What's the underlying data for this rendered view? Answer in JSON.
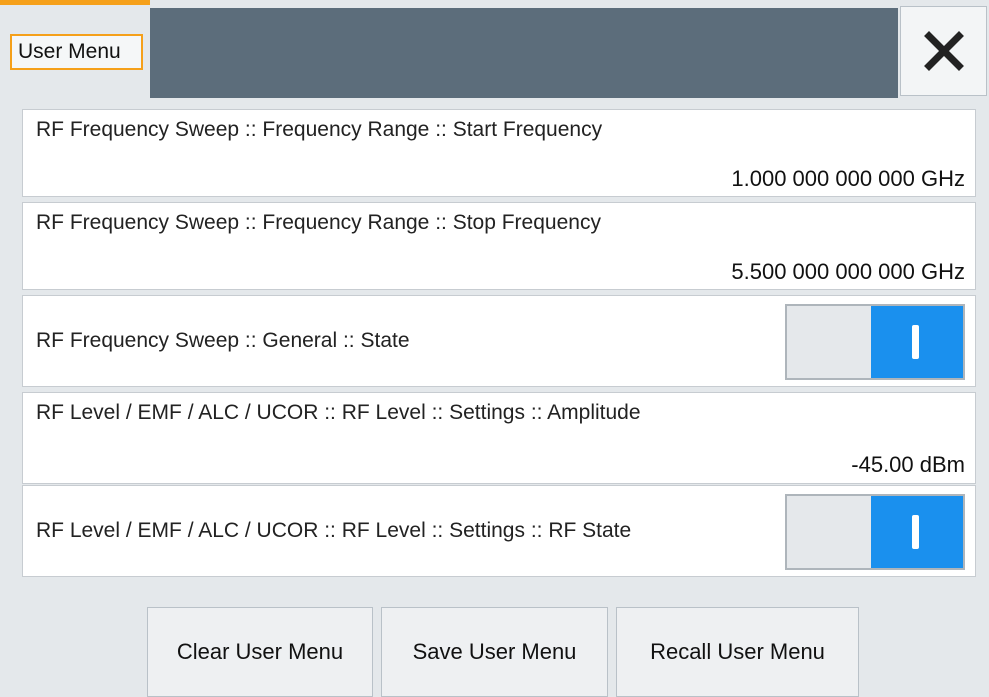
{
  "window": {
    "tab_label": "User Menu",
    "close_icon": "close-icon"
  },
  "rows": [
    {
      "label": "RF Frequency Sweep :: Frequency Range :: Start Frequency",
      "value": "1.000 000 000 000 GHz"
    },
    {
      "label": "RF Frequency Sweep :: Frequency Range :: Stop Frequency",
      "value": "5.500 000 000 000 GHz"
    },
    {
      "label": "RF Frequency Sweep :: General :: State",
      "toggle_state": "on"
    },
    {
      "label": "RF Level / EMF / ALC / UCOR :: RF Level :: Settings :: Amplitude",
      "value": "-45.00 dBm"
    },
    {
      "label": "RF Level / EMF / ALC / UCOR :: RF Level :: Settings :: RF State",
      "toggle_state": "on"
    }
  ],
  "buttons": {
    "clear": "Clear User Menu",
    "save": "Save User Menu",
    "recall": "Recall User Menu"
  },
  "colors": {
    "accent": "#f5a01a",
    "titlebar": "#5c6d7b",
    "toggle_on": "#1a90ee",
    "background": "#e4e8eb"
  }
}
